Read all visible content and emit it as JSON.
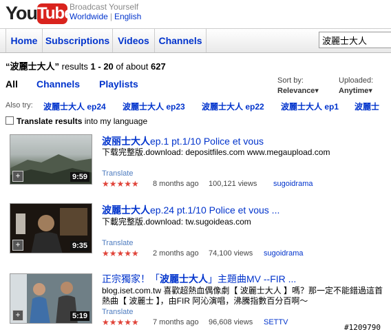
{
  "header": {
    "logo_you": "You",
    "logo_tube": "Tube",
    "tagline": "Broadcast Yourself",
    "location": "Worldwide",
    "language": "English"
  },
  "nav": {
    "tabs": [
      "Home",
      "Subscriptions",
      "Videos",
      "Channels"
    ],
    "search_value": "波麗士大人"
  },
  "results_summary": {
    "query": "“波麗士大人”",
    "text_a": " results ",
    "range": "1 - 20",
    "text_b": " of about ",
    "total": "627"
  },
  "filters": {
    "all": "All",
    "channels": "Channels",
    "playlists": "Playlists",
    "sort_label": "Sort by:",
    "sort_value": "Relevance▾",
    "uploaded_label": "Uploaded:",
    "uploaded_value": "Anytime▾"
  },
  "also_try": {
    "label": "Also try:",
    "items": [
      "波麗士大人 ep24",
      "波麗士大人 ep23",
      "波麗士大人 ep22",
      "波麗士大人 ep1",
      "波麗士"
    ]
  },
  "translate": {
    "bold": "Translate results",
    "rest": " into my language"
  },
  "results": [
    {
      "title_bold": "波丽士大人",
      "title_rest": "ep.1 pt.1/10 Police et vous",
      "description": "下载完整版.download: depositfiles.com www.megaupload.com",
      "duration": "9:59",
      "translate": "Translate",
      "stars": "★★★★★",
      "age": "8 months ago",
      "views": "100,121 views",
      "user": "sugoidrama"
    },
    {
      "title_bold": "波麗士大人",
      "title_rest": "ep.24 pt.1/10 Police et vous ...",
      "description": "下載完整版.download: tw.sugoideas.com",
      "duration": "9:35",
      "translate": "Translate",
      "stars": "★★★★★",
      "age": "2 months ago",
      "views": "74,100 views",
      "user": "sugoidrama"
    },
    {
      "title_pre": "正宗獨家！「",
      "title_bold": "波麗士大人",
      "title_rest": "」主題曲MV --FIR ...",
      "description": "blog.iset.com.tw 喜歡超熱血偶像劇【 波麗士大人 】嗎？那一定不能錯過這首熱曲【 波麗士 】，由FIR 阿沁演唱，沸騰指數百分百啊～",
      "duration": "5:19",
      "translate": "Translate",
      "stars": "★★★★★",
      "age": "7 months ago",
      "views": "96,608 views",
      "user": "SETTV"
    }
  ],
  "watermark": "#1209790",
  "colors": {
    "link": "#0033cc",
    "logo_red": "#d9231d",
    "star": "#e0443a"
  }
}
